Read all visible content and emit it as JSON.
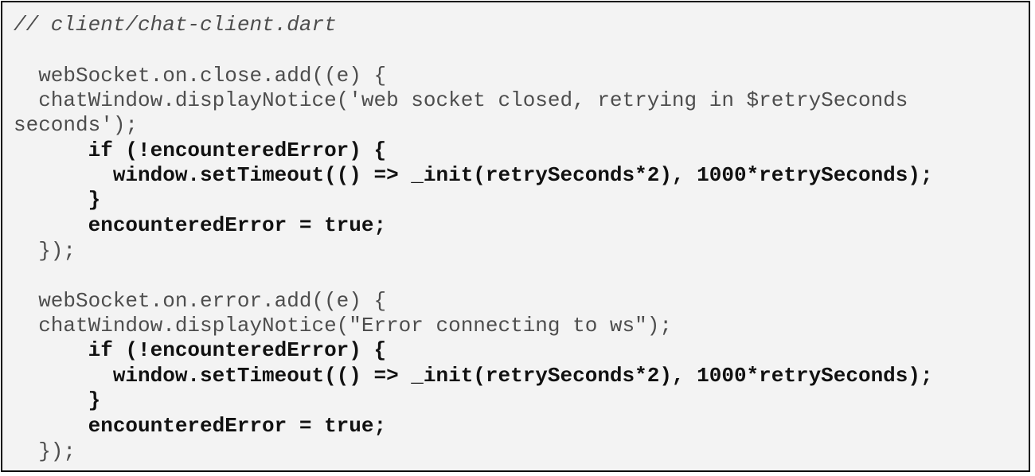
{
  "code_listing": {
    "comment": "// client/chat-client.dart",
    "close_handler": {
      "open": "  webSocket.on.close.add((e) {",
      "notice_1": "  chatWindow.displayNotice('web socket closed, retrying in $retrySeconds",
      "notice_2": "seconds');",
      "if_open": "      if (!encounteredError) {",
      "set_timeout": "        window.setTimeout(() => _init(retrySeconds*2), 1000*retrySeconds);",
      "if_close": "      }",
      "assign": "      encounteredError = true;",
      "close": "  });"
    },
    "error_handler": {
      "open": "  webSocket.on.error.add((e) {",
      "notice": "  chatWindow.displayNotice(\"Error connecting to ws\");",
      "if_open": "      if (!encounteredError) {",
      "set_timeout": "        window.setTimeout(() => _init(retrySeconds*2), 1000*retrySeconds);",
      "if_close": "      }",
      "assign": "      encounteredError = true;",
      "close": "  });"
    }
  }
}
